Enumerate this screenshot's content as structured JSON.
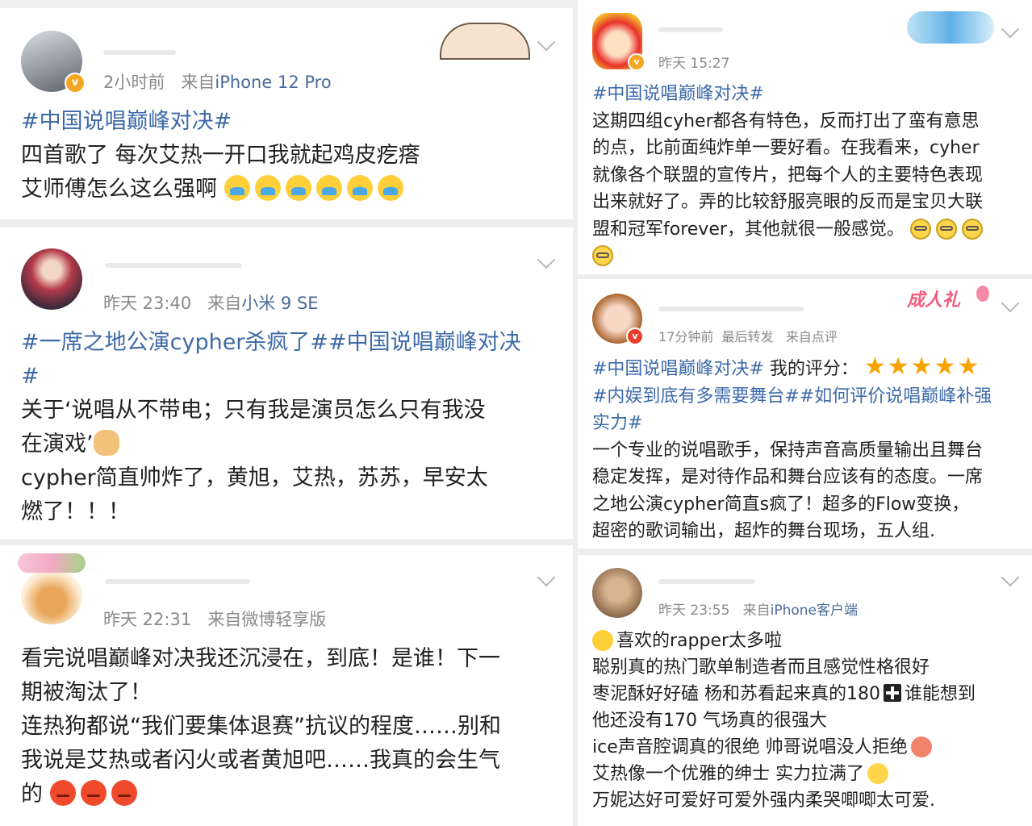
{
  "posts": [
    {
      "time": "2小时前",
      "source_prefix": "来自",
      "source": "iPhone 12 Pro",
      "lines": [
        "#中国说唱巅峰对决#",
        "四首歌了 每次艾热一开口我就起鸡皮疙瘩",
        "艾师傅怎么这么强啊"
      ]
    },
    {
      "time": "昨天 23:40",
      "source_prefix": "来自",
      "source": "小米 9 SE",
      "lines": [
        "#一席之地公演cypher杀疯了##中国说唱巅峰对决",
        "#",
        "关于‘说唱从不带电；只有我是演员怎么只有我没",
        "在演戏’",
        "cypher简直帅炸了，黄旭，艾热，苏苏，早安太",
        "燃了！！！"
      ]
    },
    {
      "time": "昨天 22:31",
      "source_prefix": "来自",
      "source": "微博轻享版",
      "lines": [
        "看完说唱巅峰对决我还沉浸在，到底！是谁！下一",
        "期被淘汰了！",
        "连热狗都说“我们要集体退赛”抗议的程度……别和",
        "我说是艾热或者闪火或者黄旭吧……我真的会生气",
        "的"
      ]
    },
    {
      "time": "昨天 15:27",
      "lines": [
        "#中国说唱巅峰对决#",
        "这期四组cyher都各有特色，反而打出了蛮有意思",
        "的点，比前面纯炸单一要好看。在我看来，cyher",
        "就像各个联盟的宣传片，把每个人的主要特色表现",
        "出来就好了。弄的比较舒服亮眼的反而是宝贝大联",
        "盟和冠军forever，其他就很一般感觉。"
      ]
    },
    {
      "time": "17分钟前",
      "extra": "最后转发",
      "source_prefix": "来自",
      "source": "点评",
      "decoration": "成人礼",
      "rating_tag": "#中国说唱巅峰对决#",
      "rating_label": "我的评分：",
      "rating": 5,
      "lines": [
        "#内娱到底有多需要舞台##如何评价说唱巅峰补强",
        "实力#",
        "一个专业的说唱歌手，保持声音高质量输出且舞台",
        "稳定发挥，是对待作品和舞台应该有的态度。一席",
        "之地公演cypher简直s疯了！超多的Flow变换，",
        "超密的歌词输出，超炸的舞台现场，五人组."
      ]
    },
    {
      "time": "昨天 23:55",
      "source_prefix": "来自",
      "source": "iPhone客户端",
      "lines": [
        "喜欢的rapper太多啦",
        "聪别真的热门歌单制造者而且感觉性格很好",
        "枣泥酥好好磕 杨和苏看起来真的180",
        "谁能想到",
        "他还没有170 气场真的很强大",
        "ice声音腔调真的很绝 帅哥说唱没人拒绝",
        "艾热像一个优雅的绅士 实力拉满了",
        "万妮达好可爱好可爱外强内柔哭唧唧太可爱."
      ]
    }
  ],
  "colors": {
    "link": "#3d6aa8",
    "meta": "#8a8a8a",
    "star": "#f7a400",
    "badge": "#f5a623"
  }
}
